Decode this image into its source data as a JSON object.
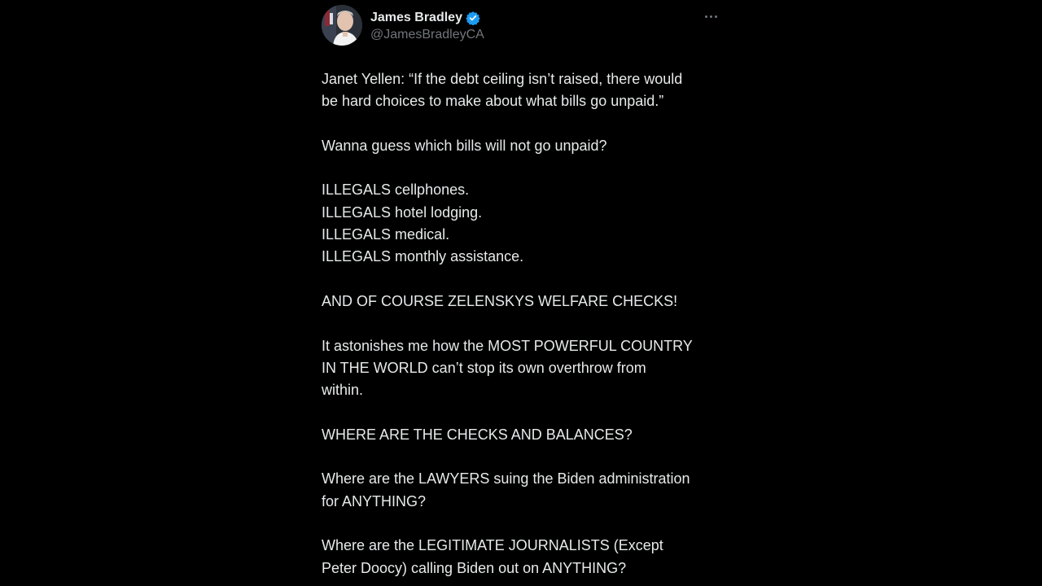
{
  "author": {
    "display_name": "James Bradley",
    "handle": "@JamesBradleyCA",
    "verified_icon": "verified-badge-icon",
    "verified_color": "#1d9bf0"
  },
  "menu": {
    "more_icon": "more-options-icon"
  },
  "tweet": {
    "paragraphs": [
      {
        "lines": [
          "Janet Yellen: “If the debt ceiling isn’t raised, there would",
          "be hard choices to make about what bills go unpaid.”"
        ]
      },
      {
        "lines": [
          "Wanna guess which bills will not go unpaid?"
        ]
      },
      {
        "lines": [
          "ILLEGALS cellphones.",
          "ILLEGALS hotel lodging.",
          "ILLEGALS medical.",
          "ILLEGALS monthly assistance."
        ]
      },
      {
        "lines": [
          "AND OF COURSE ZELENSKYS WELFARE CHECKS!"
        ]
      },
      {
        "lines": [
          "It astonishes me how the MOST POWERFUL COUNTRY",
          "IN THE WORLD can’t stop its own overthrow from",
          "within."
        ]
      },
      {
        "lines": [
          "WHERE ARE THE CHECKS AND BALANCES?"
        ]
      },
      {
        "lines": [
          "Where are the LAWYERS suing the Biden administration",
          "for ANYTHING?"
        ]
      },
      {
        "lines": [
          "Where are the LEGITIMATE JOURNALISTS (Except",
          "Peter Doocy) calling Biden out on ANYTHING?"
        ]
      }
    ]
  },
  "colors": {
    "background": "#000000",
    "primary_text": "#e7e9ea",
    "secondary_text": "#71767b"
  }
}
